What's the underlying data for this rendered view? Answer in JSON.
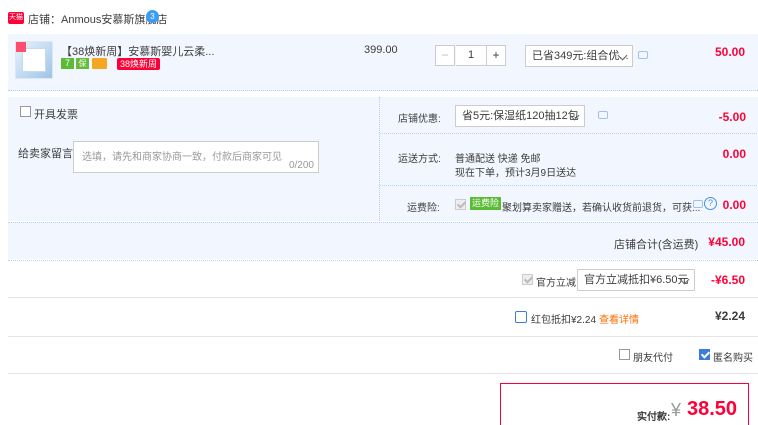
{
  "shop": {
    "badge": "天猫",
    "label": "店铺：Anmous安慕斯旗舰店",
    "chat_badge": "3"
  },
  "item": {
    "title": "【38焕新周】安慕斯婴儿云柔...",
    "tags": [
      "7",
      "保",
      ""
    ],
    "promo_tag": "38焕新周",
    "price": "399.00",
    "qty": "1",
    "minus": "−",
    "plus": "+",
    "discount_select": "已省349元:组合优...",
    "subtotal": "50.00"
  },
  "left": {
    "invoice_label": "开具发票",
    "note_label": "给卖家留言:",
    "note_placeholder": "选填，请先和商家协商一致，付款后商家可见",
    "note_counter": "0/200"
  },
  "right": {
    "store_coupon_label": "店铺优惠:",
    "store_coupon_select": "省5元:保湿纸120抽12包",
    "store_coupon_value": "-5.00",
    "shipping_label": "运送方式:",
    "shipping_text1": "普通配送 快递 免邮",
    "shipping_text2": "现在下单，预计3月9日送达",
    "shipping_value": "0.00",
    "insurance_label": "运费险:",
    "insurance_badge": "运费险",
    "insurance_text": "聚划算卖家赠送，若确认收货前退货，可获...",
    "insurance_help": "?",
    "insurance_value": "0.00"
  },
  "shop_total": {
    "label": "店铺合计(含运费)",
    "value": "¥45.00"
  },
  "official": {
    "label": "官方立减",
    "select": "官方立减抵扣¥6.50元",
    "value": "-¥6.50"
  },
  "redpacket": {
    "label": "红包抵扣¥2.24",
    "link": "查看详情",
    "value": "¥2.24"
  },
  "options": {
    "friend_pay": "朋友代付",
    "anonymous": "匿名购买"
  },
  "pay": {
    "label": "实付款:",
    "currency": "¥",
    "amount": "38.50"
  },
  "colors": {
    "price_red": "#ff0036",
    "section_bg": "#f2f7ff",
    "link_orange": "#ff6a00",
    "tmall_red": "#ff0036",
    "check_blue": "#3b7cdb"
  }
}
